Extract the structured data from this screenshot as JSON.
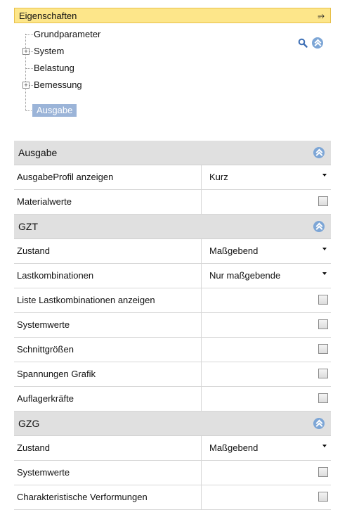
{
  "panel": {
    "title": "Eigenschaften",
    "pin_glyph": "⭌"
  },
  "tree": {
    "items": [
      {
        "label": "Grundparameter",
        "expandable": false
      },
      {
        "label": "System",
        "expandable": true
      },
      {
        "label": "Belastung",
        "expandable": false
      },
      {
        "label": "Bemessung",
        "expandable": true
      },
      {
        "label": "Ausgabe",
        "expandable": false,
        "selected": true
      }
    ],
    "icons": [
      "search-icon",
      "collapse-all-icon"
    ]
  },
  "grid": {
    "sections": [
      {
        "title": "Ausgabe",
        "rows": [
          {
            "name": "AusgabeProfil anzeigen",
            "type": "dropdown",
            "value": "Kurz"
          },
          {
            "name": "Materialwerte",
            "type": "checkbox",
            "checked": false
          }
        ]
      },
      {
        "title": "GZT",
        "rows": [
          {
            "name": "Zustand",
            "type": "dropdown",
            "value": "Maßgebend"
          },
          {
            "name": "Lastkombinationen",
            "type": "dropdown",
            "value": "Nur maßgebende"
          },
          {
            "name": "Liste Lastkombinationen anzeigen",
            "type": "checkbox",
            "checked": false
          },
          {
            "name": "Systemwerte",
            "type": "checkbox",
            "checked": false
          },
          {
            "name": "Schnittgrößen",
            "type": "checkbox",
            "checked": false
          },
          {
            "name": "Spannungen Grafik",
            "type": "checkbox",
            "checked": false
          },
          {
            "name": "Auflagerkräfte",
            "type": "checkbox",
            "checked": false
          }
        ]
      },
      {
        "title": "GZG",
        "rows": [
          {
            "name": "Zustand",
            "type": "dropdown",
            "value": "Maßgebend"
          },
          {
            "name": "Systemwerte",
            "type": "checkbox",
            "checked": false
          },
          {
            "name": "Charakteristische Verformungen",
            "type": "checkbox",
            "checked": false
          }
        ]
      }
    ]
  },
  "colors": {
    "title_bg": "#fde68a",
    "selection": "#9bb4d8",
    "section_bg": "#e0e0e0",
    "accent_icon": "#7da6d6"
  }
}
